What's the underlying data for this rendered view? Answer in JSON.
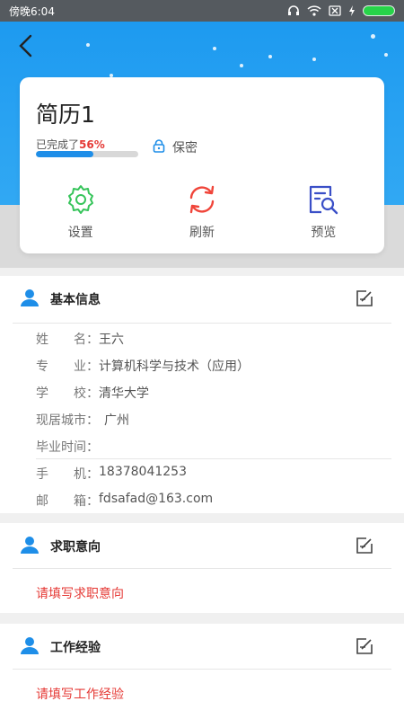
{
  "status_bar": {
    "time": "傍晚6:04"
  },
  "header": {
    "back_icon": "chevron-left-icon"
  },
  "resume": {
    "title": "简历1",
    "progress_label": "已完成了",
    "progress_percent": "56%",
    "progress_value": 0.56,
    "privacy_label": "保密",
    "actions": [
      {
        "label": "设置",
        "icon": "gear-icon",
        "color": "#36c45a"
      },
      {
        "label": "刷新",
        "icon": "refresh-icon",
        "color": "#f0453a"
      },
      {
        "label": "预览",
        "icon": "search-document-icon",
        "color": "#3a4fc7"
      }
    ]
  },
  "basic_info": {
    "title": "基本信息",
    "fields": [
      {
        "key": "姓　　名：",
        "value": "王六"
      },
      {
        "key": "专　　业：",
        "value": "计算机科学与技术（应用）"
      },
      {
        "key": "学　　校：",
        "value": "清华大学"
      },
      {
        "key": "现居城市：",
        "value": "广州"
      },
      {
        "key": "毕业时间：",
        "value": ""
      },
      {
        "key": "手　　机：",
        "value": "18378041253"
      },
      {
        "key": "邮　　箱：",
        "value": "fdsafad@163.com"
      }
    ]
  },
  "job_intent": {
    "title": "求职意向",
    "hint": "请填写求职意向"
  },
  "work_experience": {
    "title": "工作经验",
    "hint": "请填写工作经验"
  },
  "colors": {
    "accent": "#1e8ee8",
    "warning": "#e53935",
    "header": "#2aa3f2"
  }
}
